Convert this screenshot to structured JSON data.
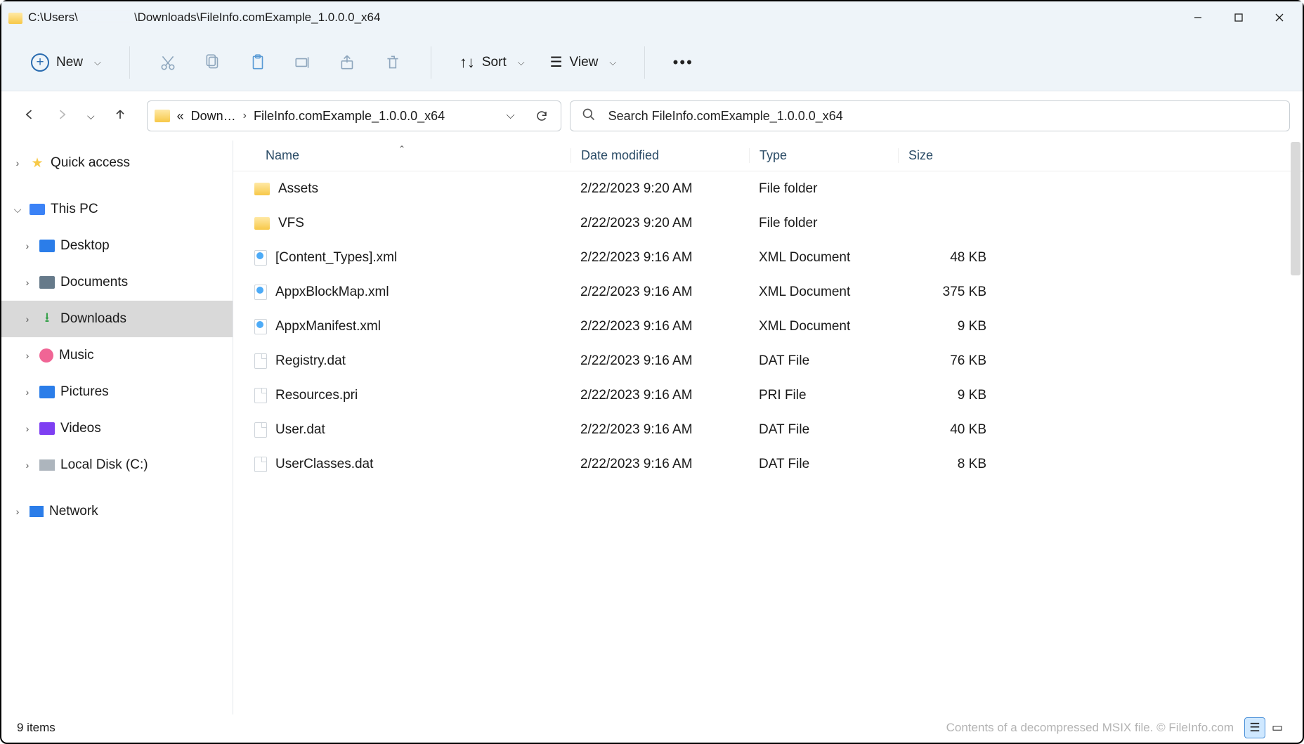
{
  "window": {
    "title_prefix": "C:\\Users\\",
    "title_suffix": "\\Downloads\\FileInfo.comExample_1.0.0.0_x64"
  },
  "toolbar": {
    "new_label": "New",
    "sort_label": "Sort",
    "view_label": "View"
  },
  "breadcrumb": {
    "laquo": "«",
    "seg1": "Down…",
    "seg2": "FileInfo.comExample_1.0.0.0_x64"
  },
  "search": {
    "placeholder": "Search FileInfo.comExample_1.0.0.0_x64"
  },
  "sidebar": {
    "quick": "Quick access",
    "thispc": "This PC",
    "desktop": "Desktop",
    "documents": "Documents",
    "downloads": "Downloads",
    "music": "Music",
    "pictures": "Pictures",
    "videos": "Videos",
    "disk": "Local Disk (C:)",
    "network": "Network"
  },
  "columns": {
    "name": "Name",
    "date": "Date modified",
    "type": "Type",
    "size": "Size"
  },
  "files": [
    {
      "icon": "folder",
      "name": "Assets",
      "date": "2/22/2023 9:20 AM",
      "type": "File folder",
      "size": ""
    },
    {
      "icon": "folder",
      "name": "VFS",
      "date": "2/22/2023 9:20 AM",
      "type": "File folder",
      "size": ""
    },
    {
      "icon": "xml",
      "name": "[Content_Types].xml",
      "date": "2/22/2023 9:16 AM",
      "type": "XML Document",
      "size": "48 KB"
    },
    {
      "icon": "xml",
      "name": "AppxBlockMap.xml",
      "date": "2/22/2023 9:16 AM",
      "type": "XML Document",
      "size": "375 KB"
    },
    {
      "icon": "xml",
      "name": "AppxManifest.xml",
      "date": "2/22/2023 9:16 AM",
      "type": "XML Document",
      "size": "9 KB"
    },
    {
      "icon": "file",
      "name": "Registry.dat",
      "date": "2/22/2023 9:16 AM",
      "type": "DAT File",
      "size": "76 KB"
    },
    {
      "icon": "file",
      "name": "Resources.pri",
      "date": "2/22/2023 9:16 AM",
      "type": "PRI File",
      "size": "9 KB"
    },
    {
      "icon": "file",
      "name": "User.dat",
      "date": "2/22/2023 9:16 AM",
      "type": "DAT File",
      "size": "40 KB"
    },
    {
      "icon": "file",
      "name": "UserClasses.dat",
      "date": "2/22/2023 9:16 AM",
      "type": "DAT File",
      "size": "8 KB"
    }
  ],
  "status": {
    "items": "9 items",
    "credit": "Contents of a decompressed MSIX file. © FileInfo.com"
  }
}
